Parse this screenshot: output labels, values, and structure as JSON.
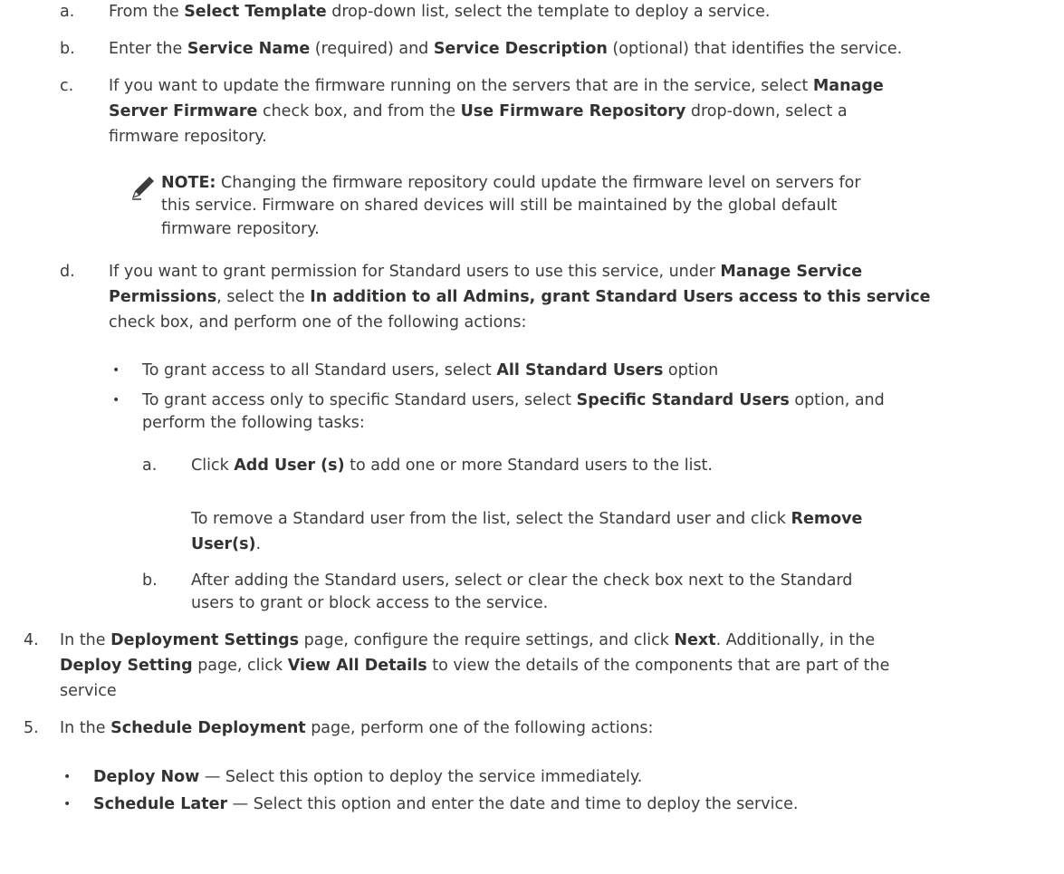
{
  "markers": {
    "a": "a.",
    "b": "b.",
    "c": "c.",
    "d": "d.",
    "four": "4.",
    "five": "5.",
    "bullet": "•"
  },
  "steps": {
    "a": {
      "t1": "From the ",
      "b1": "Select Template",
      "t2": " drop-down list, select the template to deploy a service."
    },
    "b": {
      "t1": "Enter the ",
      "b1": "Service Name",
      "t2": " (required) and ",
      "b2": "Service Description",
      "t3": " (optional) that identifies the service."
    },
    "c": {
      "line1": {
        "t1": "If you want to update the firmware running on the servers that are in the service, select ",
        "b1": "Manage"
      },
      "line2": {
        "b1": "Server Firmware",
        "t1": " check box, and from the ",
        "b2": "Use Firmware Repository",
        "t2": " drop-down, select a"
      },
      "line3": "firmware repository."
    },
    "note": {
      "label": "NOTE:",
      "line1": " Changing the firmware repository could update the firmware level on servers for",
      "line2": "this service. Firmware on shared devices will still be maintained by the global default",
      "line3": "firmware repository."
    },
    "d": {
      "line1": {
        "t1": "If you want to grant permission for Standard users to use this service, under ",
        "b1": "Manage Service"
      },
      "line2": {
        "b1": "Permissions",
        "t1": ", select the ",
        "b2": "In addition to all Admins, grant Standard Users access to this service"
      },
      "line3": "check box, and perform one of the following actions:",
      "bullet1": {
        "t1": "To grant access to all Standard users, select ",
        "b1": "All Standard Users",
        "t2": " option"
      },
      "bullet2": {
        "line1": {
          "t1": "To grant access only to specific Standard users, select ",
          "b1": "Specific Standard Users",
          "t2": " option, and"
        },
        "line2": "perform the following tasks:"
      },
      "sub_a": {
        "t1": "Click ",
        "b1": "Add User (s)",
        "t2": " to add one or more Standard users to the list."
      },
      "sub_a_extra": {
        "line1": {
          "t1": "To remove a Standard user from the list, select the Standard user and click ",
          "b1": "Remove"
        },
        "line2": {
          "b1": "User(s)",
          "t1": "."
        }
      },
      "sub_b": {
        "line1": "After adding the Standard users, select or clear the check box next to the Standard",
        "line2": "users to grant or block access to the service."
      }
    },
    "four": {
      "line1": {
        "t1": "In the ",
        "b1": "Deployment Settings",
        "t2": " page, configure the require settings, and click ",
        "b2": "Next",
        "t3": ". Additionally, in the"
      },
      "line2": {
        "b1": "Deploy Setting",
        "t1": " page, click ",
        "b2": "View All Details",
        "t2": " to view the details of the components that are part of the"
      },
      "line3": "service"
    },
    "five": {
      "line1": {
        "t1": "In the ",
        "b1": "Schedule Deployment",
        "t2": " page, perform one of the following actions:"
      },
      "bullet1": {
        "b1": "Deploy Now",
        "t1": " — Select this option to deploy the service immediately."
      },
      "bullet2": {
        "b1": "Schedule Later",
        "t1": " — Select this option and enter the date and time to deploy the service."
      }
    }
  },
  "icon": "pencil-note-icon"
}
